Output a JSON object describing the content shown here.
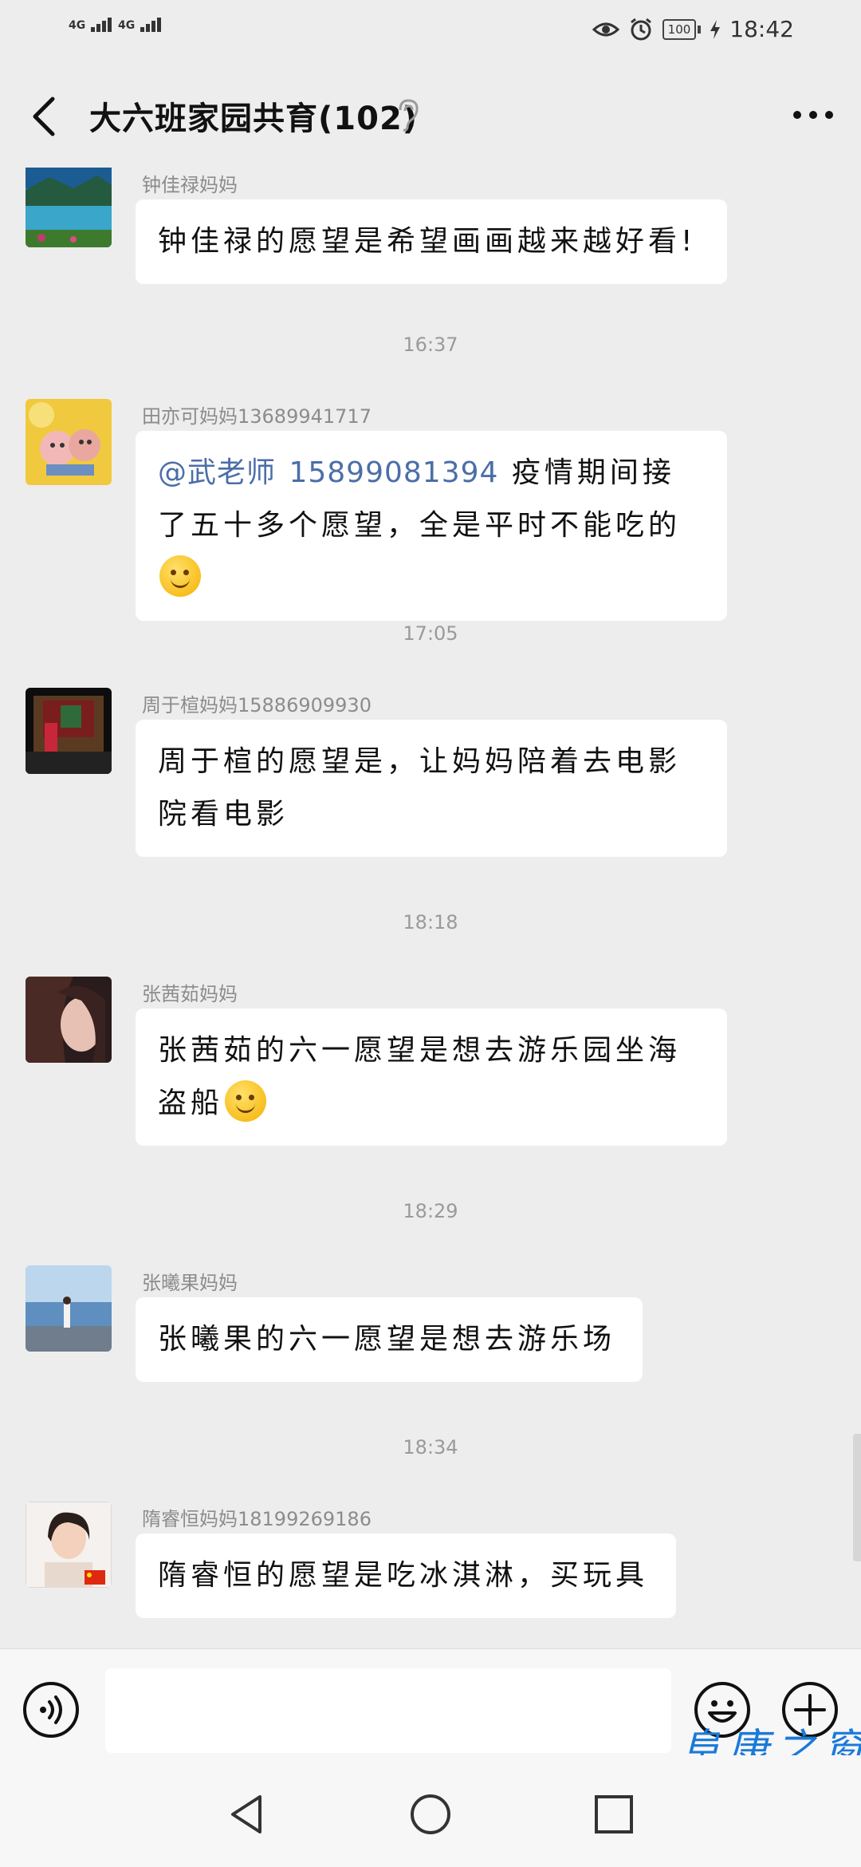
{
  "status_bar": {
    "signal1": "4G",
    "signal2": "4G",
    "battery": "100",
    "time": "18:42"
  },
  "header": {
    "title": "大六班家园共育(102)"
  },
  "messages": [
    {
      "sender": "钟佳禄妈妈",
      "text": "钟佳禄的愿望是希望画画越来越好看!"
    },
    {
      "time": "16:37"
    },
    {
      "sender": "田亦可妈妈13689941717",
      "mention": "@武老师",
      "phone": "15899081394",
      "text": "疫情期间接了五十多个愿望，全是平时不能吃的"
    },
    {
      "time": "17:05"
    },
    {
      "sender": "周于楦妈妈15886909930",
      "text": "周于楦的愿望是，让妈妈陪着去电影院看电影"
    },
    {
      "time": "18:18"
    },
    {
      "sender": "张茜茹妈妈",
      "text": "张茜茹的六一愿望是想去游乐园坐海盗船"
    },
    {
      "time": "18:29"
    },
    {
      "sender": "张曦果妈妈",
      "text": "张曦果的六一愿望是想去游乐场"
    },
    {
      "time": "18:34"
    },
    {
      "sender": "隋睿恒妈妈18199269186",
      "text": "隋睿恒的愿望是吃冰淇淋，买玩具"
    }
  ],
  "input": {
    "placeholder": ""
  },
  "watermark": "阜康之窗",
  "colors": {
    "background": "#ededed",
    "bubble": "#ffffff",
    "mention": "#4b6ea8",
    "watermark": "#1a7ad8"
  }
}
